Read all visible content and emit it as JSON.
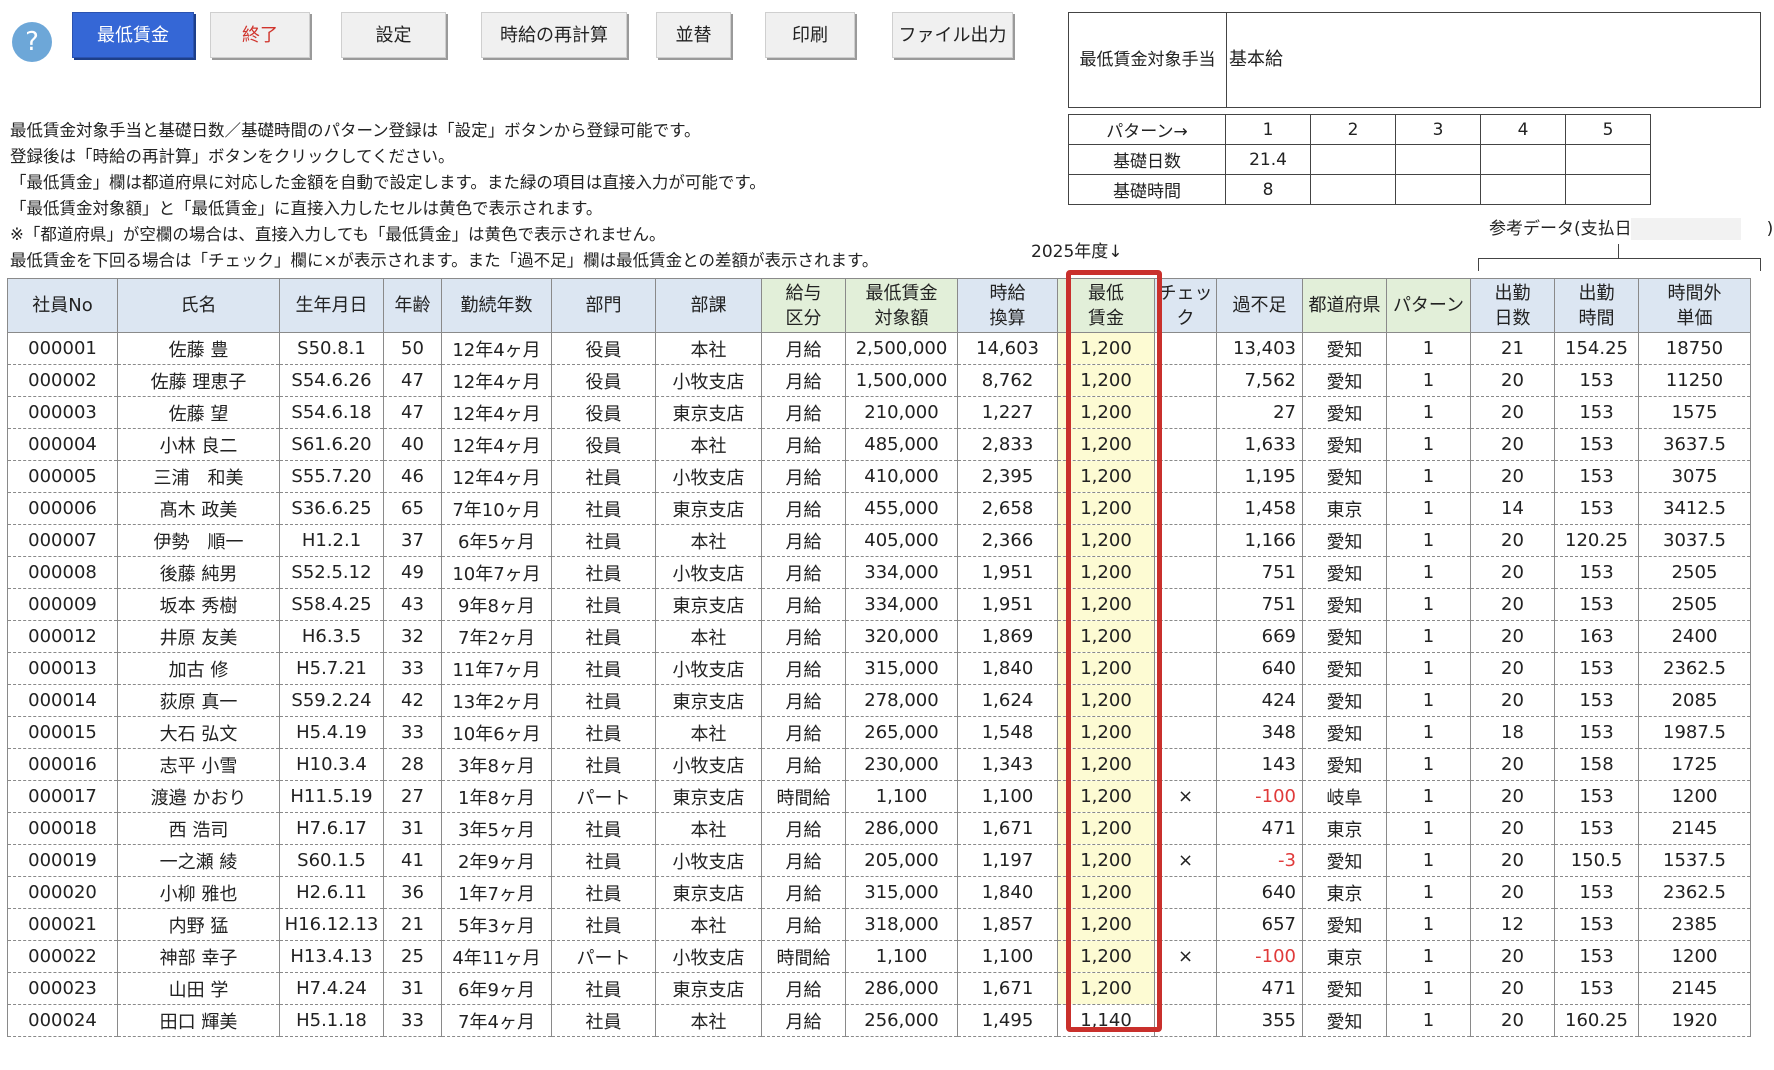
{
  "toolbar": {
    "help": "?",
    "buttons": {
      "minwage": "最低賃金",
      "exit": "終了",
      "settings": "設定",
      "recalc": "時給の再計算",
      "sort": "並替",
      "print": "印刷",
      "export": "ファイル出力"
    }
  },
  "info": {
    "allowance_label": "最低賃金対象手当",
    "allowance_value": "基本給"
  },
  "pattern": {
    "header": "パターン→",
    "numbers": [
      "1",
      "2",
      "3",
      "4",
      "5"
    ],
    "days_label": "基礎日数",
    "days": [
      "21.4",
      "",
      "",
      "",
      ""
    ],
    "hours_label": "基礎時間",
    "hours": [
      "8",
      "",
      "",
      "",
      ""
    ]
  },
  "notes": [
    "最低賃金対象手当と基礎日数／基礎時間のパターン登録は「設定」ボタンから登録可能です。",
    "登録後は「時給の再計算」ボタンをクリックしてください。",
    "「最低賃金」欄は都道府県に対応した金額を自動で設定します。また緑の項目は直接入力が可能です。",
    "「最低賃金対象額」と「最低賃金」に直接入力したセルは黄色で表示されます。",
    "※「都道府県」が空欄の場合は、直接入力しても「最低賃金」は黄色で表示されません。",
    "最低賃金を下回る場合は「チェック」欄に×が表示されます。また「過不足」欄は最低賃金との差額が表示されます。"
  ],
  "year_label": "2025年度↓",
  "ref_label": "参考データ(支払日：",
  "ref_close": ")",
  "colors": {
    "header_blue": "#dce6f2",
    "header_green": "#e2efd9",
    "highlight_yellow": "#fdfbd3",
    "outline_red": "#c9302c",
    "negative_red": "#e03a3a",
    "primary_button": "#3567d6"
  },
  "table": {
    "headers": [
      {
        "l1": "社員No",
        "l2": ""
      },
      {
        "l1": "氏名",
        "l2": ""
      },
      {
        "l1": "生年月日",
        "l2": ""
      },
      {
        "l1": "年齢",
        "l2": ""
      },
      {
        "l1": "勤続年数",
        "l2": ""
      },
      {
        "l1": "部門",
        "l2": ""
      },
      {
        "l1": "部課",
        "l2": ""
      },
      {
        "l1": "給与",
        "l2": "区分"
      },
      {
        "l1": "最低賃金",
        "l2": "対象額"
      },
      {
        "l1": "時給",
        "l2": "換算"
      },
      {
        "l1": "最低",
        "l2": "賃金"
      },
      {
        "l1": "チェック",
        "l2": ""
      },
      {
        "l1": "過不足",
        "l2": ""
      },
      {
        "l1": "都道府県",
        "l2": ""
      },
      {
        "l1": "パターン",
        "l2": ""
      },
      {
        "l1": "出勤",
        "l2": "日数"
      },
      {
        "l1": "出勤",
        "l2": "時間"
      },
      {
        "l1": "時間外",
        "l2": "単価"
      }
    ],
    "rows": [
      [
        "000001",
        "佐藤 豊",
        "S50.8.1",
        "50",
        "12年4ヶ月",
        "役員",
        "本社",
        "月給",
        "2,500,000",
        "14,603",
        "1,200",
        "",
        "13,403",
        "愛知",
        "1",
        "21",
        "154.25",
        "18750"
      ],
      [
        "000002",
        "佐藤 理恵子",
        "S54.6.26",
        "47",
        "12年4ヶ月",
        "役員",
        "小牧支店",
        "月給",
        "1,500,000",
        "8,762",
        "1,200",
        "",
        "7,562",
        "愛知",
        "1",
        "20",
        "153",
        "11250"
      ],
      [
        "000003",
        "佐藤 望",
        "S54.6.18",
        "47",
        "12年4ヶ月",
        "役員",
        "東京支店",
        "月給",
        "210,000",
        "1,227",
        "1,200",
        "",
        "27",
        "愛知",
        "1",
        "20",
        "153",
        "1575"
      ],
      [
        "000004",
        "小林 良二",
        "S61.6.20",
        "40",
        "12年4ヶ月",
        "役員",
        "本社",
        "月給",
        "485,000",
        "2,833",
        "1,200",
        "",
        "1,633",
        "愛知",
        "1",
        "20",
        "153",
        "3637.5"
      ],
      [
        "000005",
        "三浦　和美",
        "S55.7.20",
        "46",
        "12年4ヶ月",
        "社員",
        "小牧支店",
        "月給",
        "410,000",
        "2,395",
        "1,200",
        "",
        "1,195",
        "愛知",
        "1",
        "20",
        "153",
        "3075"
      ],
      [
        "000006",
        "髙木 政美",
        "S36.6.25",
        "65",
        "7年10ヶ月",
        "社員",
        "東京支店",
        "月給",
        "455,000",
        "2,658",
        "1,200",
        "",
        "1,458",
        "東京",
        "1",
        "14",
        "153",
        "3412.5"
      ],
      [
        "000007",
        "伊勢　順一",
        "H1.2.1",
        "37",
        "6年5ヶ月",
        "社員",
        "本社",
        "月給",
        "405,000",
        "2,366",
        "1,200",
        "",
        "1,166",
        "愛知",
        "1",
        "20",
        "120.25",
        "3037.5"
      ],
      [
        "000008",
        "後藤 純男",
        "S52.5.12",
        "49",
        "10年7ヶ月",
        "社員",
        "小牧支店",
        "月給",
        "334,000",
        "1,951",
        "1,200",
        "",
        "751",
        "愛知",
        "1",
        "20",
        "153",
        "2505"
      ],
      [
        "000009",
        "坂本 秀樹",
        "S58.4.25",
        "43",
        "9年8ヶ月",
        "社員",
        "東京支店",
        "月給",
        "334,000",
        "1,951",
        "1,200",
        "",
        "751",
        "愛知",
        "1",
        "20",
        "153",
        "2505"
      ],
      [
        "000012",
        "井原 友美",
        "H6.3.5",
        "32",
        "7年2ヶ月",
        "社員",
        "本社",
        "月給",
        "320,000",
        "1,869",
        "1,200",
        "",
        "669",
        "愛知",
        "1",
        "20",
        "163",
        "2400"
      ],
      [
        "000013",
        "加古 修",
        "H5.7.21",
        "33",
        "11年7ヶ月",
        "社員",
        "小牧支店",
        "月給",
        "315,000",
        "1,840",
        "1,200",
        "",
        "640",
        "愛知",
        "1",
        "20",
        "153",
        "2362.5"
      ],
      [
        "000014",
        "荻原 真一",
        "S59.2.24",
        "42",
        "13年2ヶ月",
        "社員",
        "東京支店",
        "月給",
        "278,000",
        "1,624",
        "1,200",
        "",
        "424",
        "愛知",
        "1",
        "20",
        "153",
        "2085"
      ],
      [
        "000015",
        "大石 弘文",
        "H5.4.19",
        "33",
        "10年6ヶ月",
        "社員",
        "本社",
        "月給",
        "265,000",
        "1,548",
        "1,200",
        "",
        "348",
        "愛知",
        "1",
        "18",
        "153",
        "1987.5"
      ],
      [
        "000016",
        "志平 小雪",
        "H10.3.4",
        "28",
        "3年8ヶ月",
        "社員",
        "小牧支店",
        "月給",
        "230,000",
        "1,343",
        "1,200",
        "",
        "143",
        "愛知",
        "1",
        "20",
        "158",
        "1725"
      ],
      [
        "000017",
        "渡邉 かおり",
        "H11.5.19",
        "27",
        "1年8ヶ月",
        "パート",
        "東京支店",
        "時間給",
        "1,100",
        "1,100",
        "1,200",
        "×",
        "-100",
        "岐阜",
        "1",
        "20",
        "153",
        "1200"
      ],
      [
        "000018",
        "西 浩司",
        "H7.6.17",
        "31",
        "3年5ヶ月",
        "社員",
        "本社",
        "月給",
        "286,000",
        "1,671",
        "1,200",
        "",
        "471",
        "東京",
        "1",
        "20",
        "153",
        "2145"
      ],
      [
        "000019",
        "一之瀬 綾",
        "S60.1.5",
        "41",
        "2年9ヶ月",
        "社員",
        "小牧支店",
        "月給",
        "205,000",
        "1,197",
        "1,200",
        "×",
        "-3",
        "愛知",
        "1",
        "20",
        "150.5",
        "1537.5"
      ],
      [
        "000020",
        "小柳 雅也",
        "H2.6.11",
        "36",
        "1年7ヶ月",
        "社員",
        "東京支店",
        "月給",
        "315,000",
        "1,840",
        "1,200",
        "",
        "640",
        "東京",
        "1",
        "20",
        "153",
        "2362.5"
      ],
      [
        "000021",
        "内野 猛",
        "H16.12.13",
        "21",
        "5年3ヶ月",
        "社員",
        "本社",
        "月給",
        "318,000",
        "1,857",
        "1,200",
        "",
        "657",
        "愛知",
        "1",
        "12",
        "153",
        "2385"
      ],
      [
        "000022",
        "神部 幸子",
        "H13.4.13",
        "25",
        "4年11ヶ月",
        "パート",
        "小牧支店",
        "時間給",
        "1,100",
        "1,100",
        "1,200",
        "×",
        "-100",
        "東京",
        "1",
        "20",
        "153",
        "1200"
      ],
      [
        "000023",
        "山田 学",
        "H7.4.24",
        "31",
        "6年9ヶ月",
        "社員",
        "東京支店",
        "月給",
        "286,000",
        "1,671",
        "1,200",
        "",
        "471",
        "愛知",
        "1",
        "20",
        "153",
        "2145"
      ],
      [
        "000024",
        "田口 輝美",
        "H5.1.18",
        "33",
        "7年4ヶ月",
        "社員",
        "本社",
        "月給",
        "256,000",
        "1,495",
        "1,140",
        "",
        "355",
        "愛知",
        "1",
        "20",
        "160.25",
        "1920"
      ]
    ]
  }
}
